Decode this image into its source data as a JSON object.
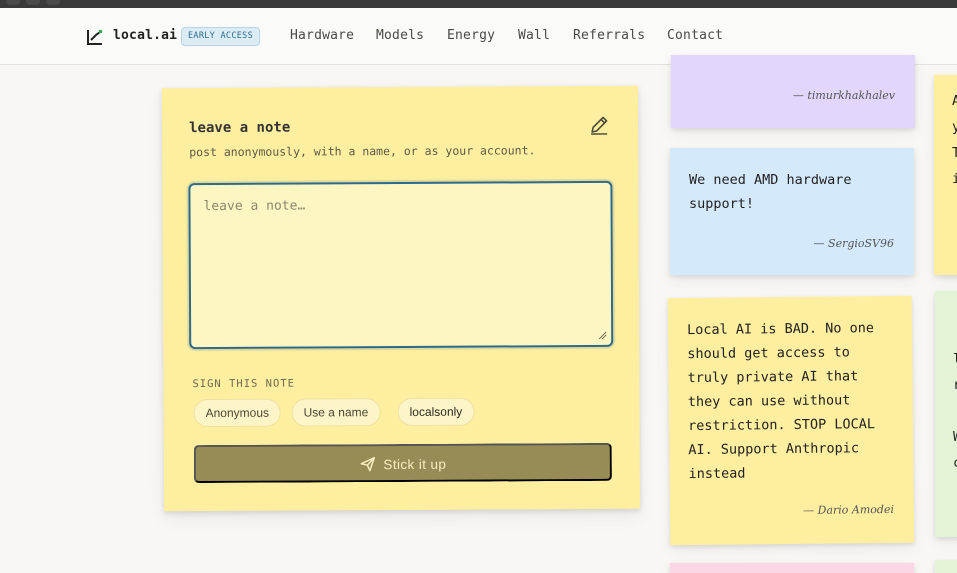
{
  "nav": {
    "brand": "local.ai",
    "badge": "EARLY ACCESS",
    "links": [
      "Hardware",
      "Models",
      "Energy",
      "Wall",
      "Referrals",
      "Contact"
    ]
  },
  "compose": {
    "title": "leave a note",
    "subtitle": "post anonymously, with a name, or as your account.",
    "placeholder": "leave a note…",
    "sign_label": "SIGN THIS NOTE",
    "sign_options": [
      "Anonymous",
      "Use a name",
      "localsonly"
    ],
    "submit_label": "Stick it up"
  },
  "wall": {
    "notes": [
      {
        "text": "",
        "signature": "— timurkhakhalev",
        "color": "#e2d6fb"
      },
      {
        "text": "We need AMD hardware support!",
        "signature": "— SergioSV96",
        "color": "#d4e9fb"
      },
      {
        "text": "Local AI is BAD. No one should get access to truly private AI that they can use without restriction. STOP LOCAL AI. Support Anthropic instead",
        "signature": "— Dario Amodei",
        "color": "#fdeea0"
      }
    ],
    "edge_fragments": {
      "yellow": [
        "A",
        "y",
        "T",
        "i"
      ],
      "green": [
        "",
        "l",
        "r",
        "W",
        "c"
      ]
    },
    "other_colors": {
      "yellow_edge": "#fdeea0",
      "green_edge": "#e3f4d6",
      "pink_edge": "#fbd6e4"
    }
  },
  "colors": {
    "accent": "#2e6a8a",
    "button": "#988c56",
    "card": "#fdeea0"
  }
}
